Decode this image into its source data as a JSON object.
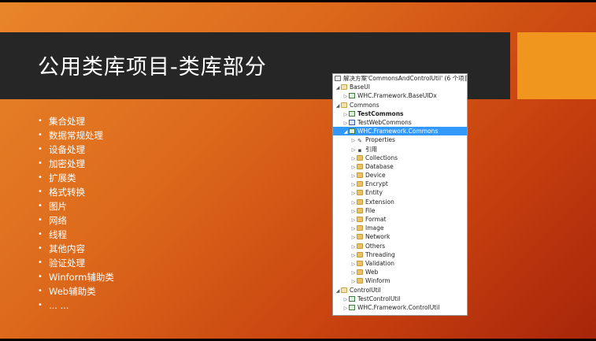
{
  "slide": {
    "title": "公用类库项目-类库部分",
    "bullets": [
      "集合处理",
      "数据常规处理",
      "设备处理",
      "加密处理",
      "扩展类",
      "格式转换",
      "图片",
      "网络",
      "线程",
      "其他内容",
      "验证处理",
      "Winform辅助类",
      "Web辅助类",
      "... ..."
    ]
  },
  "explorer": {
    "solution": "解决方案'CommonsAndControlUtil' (6 个项目)",
    "groups": {
      "baseui": "BaseUI",
      "baseui_project": "WHC.Framework.BaseUIDx",
      "commons": "Commons",
      "test_commons": "TestCommons",
      "test_web_commons": "TestWebCommons",
      "framework_commons": "WHC.Framework.Commons",
      "properties": "Properties",
      "references": "引用",
      "folders": [
        "Collections",
        "Database",
        "Device",
        "Encrypt",
        "Entity",
        "Extension",
        "File",
        "Format",
        "Image",
        "Network",
        "Others",
        "Threading",
        "Validation",
        "Web",
        "Winform"
      ],
      "controlutil": "ControlUtil",
      "test_control_util": "TestControlUtil",
      "framework_control_util": "WHC.Framework.ControlUtil"
    }
  },
  "colors": {
    "title_bar": "#262626",
    "accent": "#f0951e",
    "selection": "#3399ff"
  }
}
